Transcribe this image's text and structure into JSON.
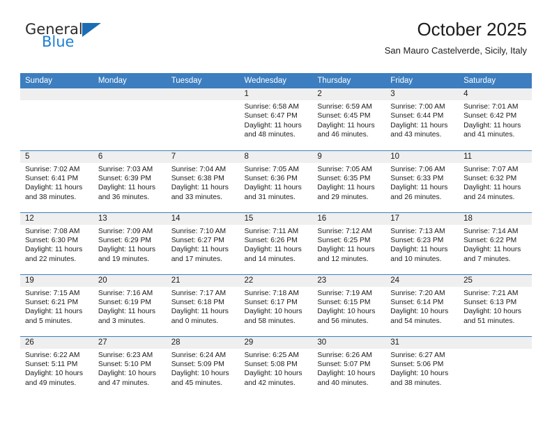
{
  "brand": {
    "name_part1": "General",
    "name_part2": "Blue",
    "logo_icon": "triangle-logo-icon",
    "accent_color": "#1c7fd4"
  },
  "header": {
    "month_title": "October 2025",
    "location": "San Mauro Castelverde, Sicily, Italy"
  },
  "calendar": {
    "header_color": "#3c7ebf",
    "daynum_strip_color": "#efefef",
    "weekday_headers": [
      "Sunday",
      "Monday",
      "Tuesday",
      "Wednesday",
      "Thursday",
      "Friday",
      "Saturday"
    ],
    "weeks": [
      [
        {
          "day": "",
          "sunrise": "",
          "sunset": "",
          "daylight_line1": "",
          "daylight_line2": "",
          "empty": true
        },
        {
          "day": "",
          "sunrise": "",
          "sunset": "",
          "daylight_line1": "",
          "daylight_line2": "",
          "empty": true
        },
        {
          "day": "",
          "sunrise": "",
          "sunset": "",
          "daylight_line1": "",
          "daylight_line2": "",
          "empty": true
        },
        {
          "day": "1",
          "sunrise": "Sunrise: 6:58 AM",
          "sunset": "Sunset: 6:47 PM",
          "daylight_line1": "Daylight: 11 hours",
          "daylight_line2": "and 48 minutes.",
          "empty": false
        },
        {
          "day": "2",
          "sunrise": "Sunrise: 6:59 AM",
          "sunset": "Sunset: 6:45 PM",
          "daylight_line1": "Daylight: 11 hours",
          "daylight_line2": "and 46 minutes.",
          "empty": false
        },
        {
          "day": "3",
          "sunrise": "Sunrise: 7:00 AM",
          "sunset": "Sunset: 6:44 PM",
          "daylight_line1": "Daylight: 11 hours",
          "daylight_line2": "and 43 minutes.",
          "empty": false
        },
        {
          "day": "4",
          "sunrise": "Sunrise: 7:01 AM",
          "sunset": "Sunset: 6:42 PM",
          "daylight_line1": "Daylight: 11 hours",
          "daylight_line2": "and 41 minutes.",
          "empty": false
        }
      ],
      [
        {
          "day": "5",
          "sunrise": "Sunrise: 7:02 AM",
          "sunset": "Sunset: 6:41 PM",
          "daylight_line1": "Daylight: 11 hours",
          "daylight_line2": "and 38 minutes.",
          "empty": false
        },
        {
          "day": "6",
          "sunrise": "Sunrise: 7:03 AM",
          "sunset": "Sunset: 6:39 PM",
          "daylight_line1": "Daylight: 11 hours",
          "daylight_line2": "and 36 minutes.",
          "empty": false
        },
        {
          "day": "7",
          "sunrise": "Sunrise: 7:04 AM",
          "sunset": "Sunset: 6:38 PM",
          "daylight_line1": "Daylight: 11 hours",
          "daylight_line2": "and 33 minutes.",
          "empty": false
        },
        {
          "day": "8",
          "sunrise": "Sunrise: 7:05 AM",
          "sunset": "Sunset: 6:36 PM",
          "daylight_line1": "Daylight: 11 hours",
          "daylight_line2": "and 31 minutes.",
          "empty": false
        },
        {
          "day": "9",
          "sunrise": "Sunrise: 7:05 AM",
          "sunset": "Sunset: 6:35 PM",
          "daylight_line1": "Daylight: 11 hours",
          "daylight_line2": "and 29 minutes.",
          "empty": false
        },
        {
          "day": "10",
          "sunrise": "Sunrise: 7:06 AM",
          "sunset": "Sunset: 6:33 PM",
          "daylight_line1": "Daylight: 11 hours",
          "daylight_line2": "and 26 minutes.",
          "empty": false
        },
        {
          "day": "11",
          "sunrise": "Sunrise: 7:07 AM",
          "sunset": "Sunset: 6:32 PM",
          "daylight_line1": "Daylight: 11 hours",
          "daylight_line2": "and 24 minutes.",
          "empty": false
        }
      ],
      [
        {
          "day": "12",
          "sunrise": "Sunrise: 7:08 AM",
          "sunset": "Sunset: 6:30 PM",
          "daylight_line1": "Daylight: 11 hours",
          "daylight_line2": "and 22 minutes.",
          "empty": false
        },
        {
          "day": "13",
          "sunrise": "Sunrise: 7:09 AM",
          "sunset": "Sunset: 6:29 PM",
          "daylight_line1": "Daylight: 11 hours",
          "daylight_line2": "and 19 minutes.",
          "empty": false
        },
        {
          "day": "14",
          "sunrise": "Sunrise: 7:10 AM",
          "sunset": "Sunset: 6:27 PM",
          "daylight_line1": "Daylight: 11 hours",
          "daylight_line2": "and 17 minutes.",
          "empty": false
        },
        {
          "day": "15",
          "sunrise": "Sunrise: 7:11 AM",
          "sunset": "Sunset: 6:26 PM",
          "daylight_line1": "Daylight: 11 hours",
          "daylight_line2": "and 14 minutes.",
          "empty": false
        },
        {
          "day": "16",
          "sunrise": "Sunrise: 7:12 AM",
          "sunset": "Sunset: 6:25 PM",
          "daylight_line1": "Daylight: 11 hours",
          "daylight_line2": "and 12 minutes.",
          "empty": false
        },
        {
          "day": "17",
          "sunrise": "Sunrise: 7:13 AM",
          "sunset": "Sunset: 6:23 PM",
          "daylight_line1": "Daylight: 11 hours",
          "daylight_line2": "and 10 minutes.",
          "empty": false
        },
        {
          "day": "18",
          "sunrise": "Sunrise: 7:14 AM",
          "sunset": "Sunset: 6:22 PM",
          "daylight_line1": "Daylight: 11 hours",
          "daylight_line2": "and 7 minutes.",
          "empty": false
        }
      ],
      [
        {
          "day": "19",
          "sunrise": "Sunrise: 7:15 AM",
          "sunset": "Sunset: 6:21 PM",
          "daylight_line1": "Daylight: 11 hours",
          "daylight_line2": "and 5 minutes.",
          "empty": false
        },
        {
          "day": "20",
          "sunrise": "Sunrise: 7:16 AM",
          "sunset": "Sunset: 6:19 PM",
          "daylight_line1": "Daylight: 11 hours",
          "daylight_line2": "and 3 minutes.",
          "empty": false
        },
        {
          "day": "21",
          "sunrise": "Sunrise: 7:17 AM",
          "sunset": "Sunset: 6:18 PM",
          "daylight_line1": "Daylight: 11 hours",
          "daylight_line2": "and 0 minutes.",
          "empty": false
        },
        {
          "day": "22",
          "sunrise": "Sunrise: 7:18 AM",
          "sunset": "Sunset: 6:17 PM",
          "daylight_line1": "Daylight: 10 hours",
          "daylight_line2": "and 58 minutes.",
          "empty": false
        },
        {
          "day": "23",
          "sunrise": "Sunrise: 7:19 AM",
          "sunset": "Sunset: 6:15 PM",
          "daylight_line1": "Daylight: 10 hours",
          "daylight_line2": "and 56 minutes.",
          "empty": false
        },
        {
          "day": "24",
          "sunrise": "Sunrise: 7:20 AM",
          "sunset": "Sunset: 6:14 PM",
          "daylight_line1": "Daylight: 10 hours",
          "daylight_line2": "and 54 minutes.",
          "empty": false
        },
        {
          "day": "25",
          "sunrise": "Sunrise: 7:21 AM",
          "sunset": "Sunset: 6:13 PM",
          "daylight_line1": "Daylight: 10 hours",
          "daylight_line2": "and 51 minutes.",
          "empty": false
        }
      ],
      [
        {
          "day": "26",
          "sunrise": "Sunrise: 6:22 AM",
          "sunset": "Sunset: 5:11 PM",
          "daylight_line1": "Daylight: 10 hours",
          "daylight_line2": "and 49 minutes.",
          "empty": false
        },
        {
          "day": "27",
          "sunrise": "Sunrise: 6:23 AM",
          "sunset": "Sunset: 5:10 PM",
          "daylight_line1": "Daylight: 10 hours",
          "daylight_line2": "and 47 minutes.",
          "empty": false
        },
        {
          "day": "28",
          "sunrise": "Sunrise: 6:24 AM",
          "sunset": "Sunset: 5:09 PM",
          "daylight_line1": "Daylight: 10 hours",
          "daylight_line2": "and 45 minutes.",
          "empty": false
        },
        {
          "day": "29",
          "sunrise": "Sunrise: 6:25 AM",
          "sunset": "Sunset: 5:08 PM",
          "daylight_line1": "Daylight: 10 hours",
          "daylight_line2": "and 42 minutes.",
          "empty": false
        },
        {
          "day": "30",
          "sunrise": "Sunrise: 6:26 AM",
          "sunset": "Sunset: 5:07 PM",
          "daylight_line1": "Daylight: 10 hours",
          "daylight_line2": "and 40 minutes.",
          "empty": false
        },
        {
          "day": "31",
          "sunrise": "Sunrise: 6:27 AM",
          "sunset": "Sunset: 5:06 PM",
          "daylight_line1": "Daylight: 10 hours",
          "daylight_line2": "and 38 minutes.",
          "empty": false
        },
        {
          "day": "",
          "sunrise": "",
          "sunset": "",
          "daylight_line1": "",
          "daylight_line2": "",
          "empty": true
        }
      ]
    ]
  }
}
